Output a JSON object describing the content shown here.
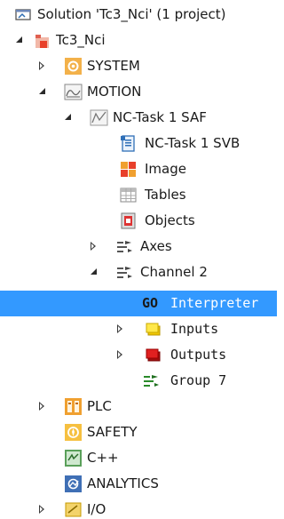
{
  "tree": {
    "solution": "Solution 'Tc3_Nci' (1 project)",
    "project": "Tc3_Nci",
    "system": "SYSTEM",
    "motion": "MOTION",
    "nc_task_saf": "NC-Task 1 SAF",
    "nc_task_svb": "NC-Task 1 SVB",
    "image": "Image",
    "tables": "Tables",
    "objects": "Objects",
    "axes": "Axes",
    "channel": "Channel 2",
    "interpreter_badge": "GO",
    "interpreter": "Interpreter",
    "inputs": "Inputs",
    "outputs": "Outputs",
    "group": "Group 7",
    "plc": "PLC",
    "safety": "SAFETY",
    "cpp": "C++",
    "analytics": "ANALYTICS",
    "io": "I/O"
  },
  "colors": {
    "selection": "#3399ff",
    "project_icon": "#e8402a",
    "system_icon": "#f0a030",
    "go_badge": "#1a1a1a"
  }
}
